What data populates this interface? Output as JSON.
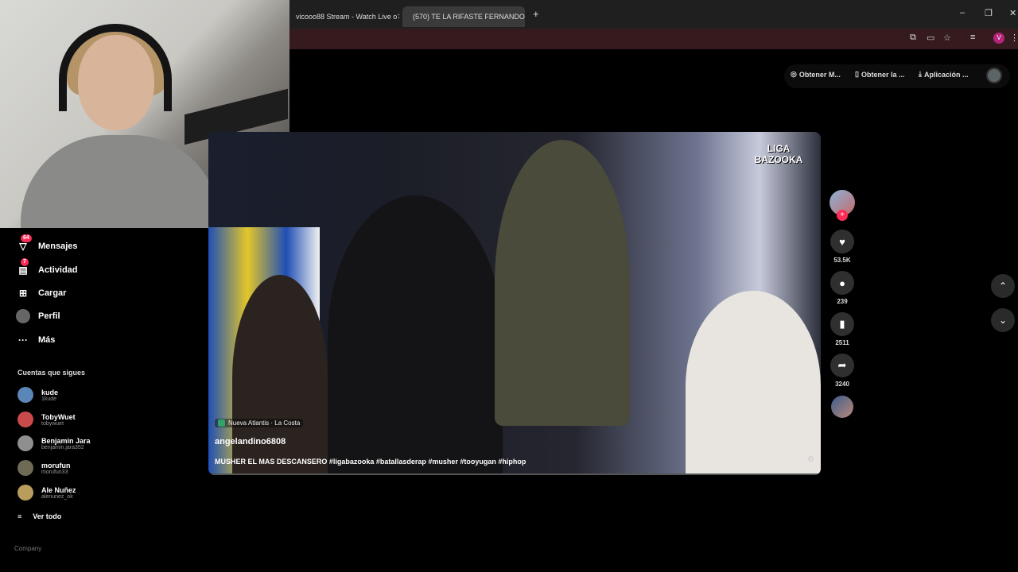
{
  "browser": {
    "tabs": [
      {
        "label": "vicooo88 Stream - Watch Live o"
      },
      {
        "label": "(570) TE LA RIFASTE FERNANDO"
      }
    ],
    "new_tab": "+",
    "window": {
      "minimize": "–",
      "restore": "❐",
      "close": "✕"
    },
    "profile_initial": "V"
  },
  "topbar": {
    "btn1": "Obtener M...",
    "btn2": "Obtener la ...",
    "btn3": "Aplicación ..."
  },
  "sidebar": {
    "items": [
      {
        "label": "Mensajes",
        "badge": "64"
      },
      {
        "label": "Actividad",
        "badge": "7"
      },
      {
        "label": "Cargar"
      },
      {
        "label": "Perfil"
      },
      {
        "label": "Más"
      }
    ],
    "following_title": "Cuentas que sigues",
    "accounts": [
      {
        "name": "kude",
        "handle": "1kude",
        "color": "#5a86b8"
      },
      {
        "name": "TobyWuet",
        "handle": "tobywuet",
        "color": "#c94a4a"
      },
      {
        "name": "Benjamin Jara",
        "handle": "benjamin.jara352",
        "color": "#8f8f8f"
      },
      {
        "name": "morufun",
        "handle": "morufun33",
        "color": "#6f6a55"
      },
      {
        "name": "Ale Nuñez",
        "handle": "alenunez_ok",
        "color": "#b89d5c"
      }
    ],
    "see_all": "Ver todo",
    "company": "Company"
  },
  "video": {
    "logo": "LIGA BAZOOKA",
    "location": "Nueva Atlantis · La Costa",
    "author": "angelandino6808",
    "caption": "MUSHER EL MAS DESCANSERO #ligabazooka #batallasderap #musher #tooyugan  #hiphop"
  },
  "actions": {
    "likes": "53.5K",
    "comments": "239",
    "saves": "2511",
    "shares": "3240"
  },
  "colors": {
    "accent": "#fe2c55",
    "addressbar": "#351b1d"
  }
}
